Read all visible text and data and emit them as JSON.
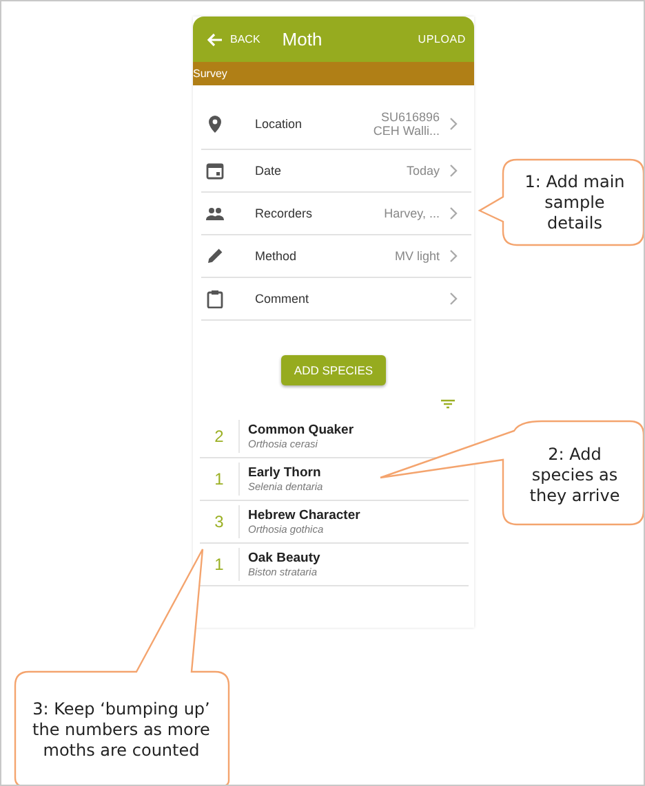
{
  "header": {
    "back": "BACK",
    "title": "Moth",
    "action": "UPLOAD"
  },
  "survey_bar": {
    "label": "Survey"
  },
  "details": [
    {
      "kind": "location",
      "label": "Location",
      "value_lines": [
        "SU616896",
        "CEH Walli..."
      ]
    },
    {
      "kind": "date",
      "label": "Date",
      "value_lines": [
        "Today"
      ]
    },
    {
      "kind": "recorders",
      "label": "Recorders",
      "value_lines": [
        "Harvey, ..."
      ]
    },
    {
      "kind": "method",
      "label": "Method",
      "value_lines": [
        "MV light"
      ]
    },
    {
      "kind": "comment",
      "label": "Comment"
    }
  ],
  "add_button": "ADD SPECIES",
  "species": [
    {
      "count": "2",
      "common": "Common Quaker",
      "latin": "Orthosia cerasi"
    },
    {
      "count": "1",
      "common": "Early Thorn",
      "latin": "Selenia dentaria"
    },
    {
      "count": "3",
      "common": "Hebrew Character",
      "latin": "Orthosia gothica"
    },
    {
      "count": "1",
      "common": "Oak Beauty",
      "latin": "Biston strataria"
    }
  ],
  "callouts": [
    {
      "text": "1: Add main sample details"
    },
    {
      "text": "2: Add species as they arrive"
    },
    {
      "text": "3: Keep ‘bumping up’ the numbers as more moths are counted"
    }
  ]
}
